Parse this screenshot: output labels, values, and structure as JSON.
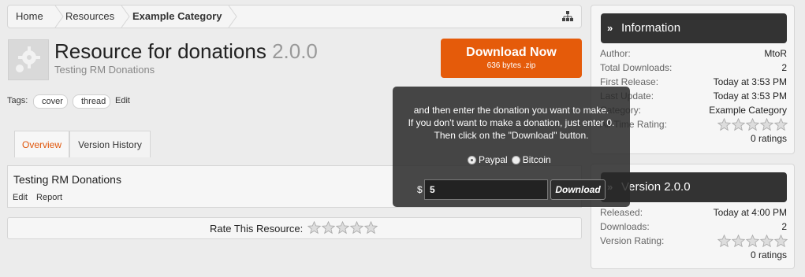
{
  "breadcrumb": {
    "items": [
      "Home",
      "Resources",
      "Example Category"
    ]
  },
  "resource": {
    "title": "Resource for donations",
    "version": "2.0.0",
    "tagline": "Testing RM Donations",
    "tags_label": "Tags:",
    "tags": [
      "cover",
      "thread"
    ],
    "tags_edit": "Edit"
  },
  "download": {
    "label": "Download Now",
    "sub": "636 bytes .zip",
    "color": "#e55b0a"
  },
  "tabs": [
    {
      "label": "Overview",
      "active": true
    },
    {
      "label": "Version History",
      "active": false
    }
  ],
  "panel": {
    "title": "Testing RM Donations",
    "links": [
      "Edit",
      "Report"
    ]
  },
  "rate": {
    "label": "Rate This Resource:"
  },
  "info": {
    "heading": "Information",
    "rows": [
      {
        "label": "Author:",
        "value": "MtoR"
      },
      {
        "label": "Total Downloads:",
        "value": "2"
      },
      {
        "label": "First Release:",
        "value": "Today at 3:53 PM"
      },
      {
        "label": "Last Update:",
        "value": "Today at 3:53 PM"
      },
      {
        "label": "Category:",
        "value": "Example Category"
      },
      {
        "label": "All-Time Rating:",
        "value": ""
      }
    ],
    "ratings": "0 ratings"
  },
  "version_box": {
    "heading": "Version 2.0.0",
    "rows": [
      {
        "label": "Released:",
        "value": "Today at 4:00 PM"
      },
      {
        "label": "Downloads:",
        "value": "2"
      },
      {
        "label": "Version Rating:",
        "value": ""
      }
    ],
    "ratings": "0 ratings"
  },
  "donation_popup": {
    "lines": [
      "and then enter the donation you want to make.",
      "If you don't want to make a donation, just enter 0.",
      "Then click on the \"Download\" button."
    ],
    "options": [
      "Paypal",
      "Bitcoin"
    ],
    "selected": "Paypal",
    "currency": "$",
    "amount": "5",
    "button": "Download"
  }
}
